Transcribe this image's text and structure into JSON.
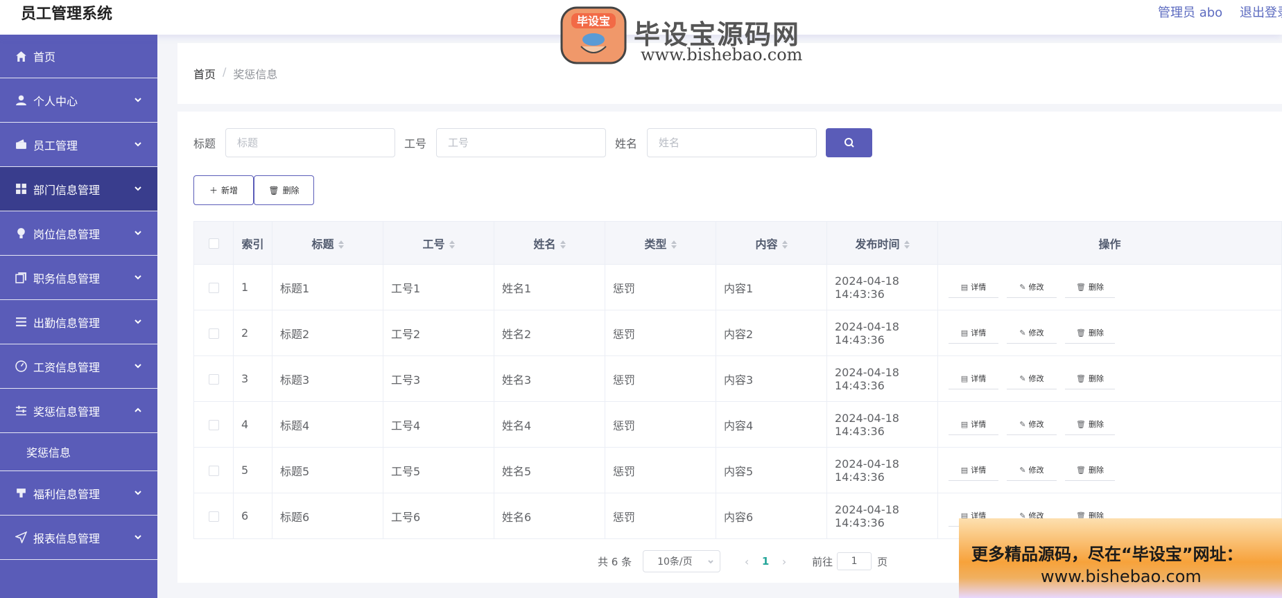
{
  "app": {
    "title": "员工管理系统",
    "user": "管理员 abo",
    "logout": "退出登录"
  },
  "sidebar": {
    "items": [
      {
        "label": "首页",
        "icon": "home-icon"
      },
      {
        "label": "个人中心",
        "icon": "user-icon"
      },
      {
        "label": "员工管理",
        "icon": "wallet-icon"
      },
      {
        "label": "部门信息管理",
        "icon": "grid-icon"
      },
      {
        "label": "岗位信息管理",
        "icon": "bulb-icon"
      },
      {
        "label": "职务信息管理",
        "icon": "copy-icon"
      },
      {
        "label": "出勤信息管理",
        "icon": "list-icon"
      },
      {
        "label": "工资信息管理",
        "icon": "gauge-icon"
      },
      {
        "label": "奖惩信息管理",
        "icon": "sliders-icon"
      },
      {
        "label": "福利信息管理",
        "icon": "stamp-icon"
      },
      {
        "label": "报表信息管理",
        "icon": "send-icon"
      }
    ],
    "submenu": {
      "label": "奖惩信息"
    }
  },
  "breadcrumb": {
    "home": "首页",
    "sep": "/",
    "current": "奖惩信息"
  },
  "search": {
    "title_label": "标题",
    "title_placeholder": "标题",
    "no_label": "工号",
    "no_placeholder": "工号",
    "name_label": "姓名",
    "name_placeholder": "姓名"
  },
  "actions": {
    "add": "新增",
    "delete": "删除"
  },
  "table": {
    "headers": {
      "index": "索引",
      "title": "标题",
      "no": "工号",
      "name": "姓名",
      "type": "类型",
      "content": "内容",
      "time": "发布时间",
      "ops": "操作"
    },
    "op_labels": {
      "detail": "详情",
      "edit": "修改",
      "delete": "删除"
    },
    "rows": [
      {
        "index": "1",
        "title": "标题1",
        "no": "工号1",
        "name": "姓名1",
        "type": "惩罚",
        "content": "内容1",
        "time": "2024-04-18 14:43:36"
      },
      {
        "index": "2",
        "title": "标题2",
        "no": "工号2",
        "name": "姓名2",
        "type": "惩罚",
        "content": "内容2",
        "time": "2024-04-18 14:43:36"
      },
      {
        "index": "3",
        "title": "标题3",
        "no": "工号3",
        "name": "姓名3",
        "type": "惩罚",
        "content": "内容3",
        "time": "2024-04-18 14:43:36"
      },
      {
        "index": "4",
        "title": "标题4",
        "no": "工号4",
        "name": "姓名4",
        "type": "惩罚",
        "content": "内容4",
        "time": "2024-04-18 14:43:36"
      },
      {
        "index": "5",
        "title": "标题5",
        "no": "工号5",
        "name": "姓名5",
        "type": "惩罚",
        "content": "内容5",
        "time": "2024-04-18 14:43:36"
      },
      {
        "index": "6",
        "title": "标题6",
        "no": "工号6",
        "name": "姓名6",
        "type": "惩罚",
        "content": "内容6",
        "time": "2024-04-18 14:43:36"
      }
    ]
  },
  "pagination": {
    "total": "共 6 条",
    "page_size": "10条/页",
    "current": "1",
    "goto_label": "前往",
    "goto_value": "1",
    "page_suffix": "页"
  },
  "watermark": {
    "brand": "毕设宝源码网",
    "url": "www.bishebao.com",
    "logo_text": "毕设宝"
  },
  "ad": {
    "line1": "更多精品源码，尽在“毕设宝”网址：",
    "line2": "www.bishebao.com"
  },
  "colors": {
    "accent": "#5a5cb8",
    "sidebar_active": "#393d8d",
    "page_current": "#26a69a"
  }
}
